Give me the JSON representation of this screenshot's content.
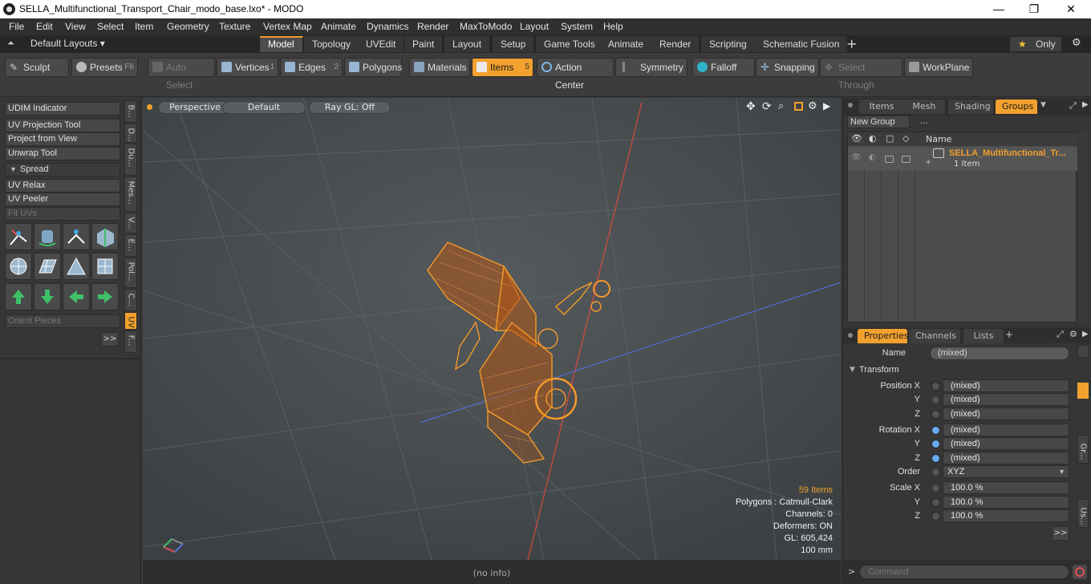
{
  "window": {
    "title": "SELLA_Multifunctional_Transport_Chair_modo_base.lxo* - MODO",
    "minimize": "—",
    "maximize": "❐",
    "close": "✕"
  },
  "menu": [
    "File",
    "Edit",
    "View",
    "Select",
    "Item",
    "Geometry",
    "Texture",
    "Vertex Map",
    "Animate",
    "Dynamics",
    "Render",
    "MaxToModo",
    "Layout",
    "System",
    "Help"
  ],
  "layout_selector": "Default Layouts ▾",
  "tabs": [
    "Model",
    "Topology",
    "UVEdit",
    "Paint",
    "Layout",
    "Setup",
    "Game Tools",
    "Animate",
    "Render",
    "Scripting",
    "Schematic Fusion"
  ],
  "active_tab": "Model",
  "only_label": "Only",
  "toolbar": {
    "sculpt": "Sculpt",
    "presets": "Presets",
    "presets_key": "F6",
    "auto_select": "Auto Select",
    "vertices": "Vertices",
    "vertices_num": "1",
    "edges": "Edges",
    "edges_num": "2",
    "polygons": "Polygons",
    "materials": "Materials",
    "items": "Items",
    "items_num": "5",
    "action_center": "Action Center",
    "symmetry": "Symmetry",
    "falloff": "Falloff",
    "snapping": "Snapping",
    "select_through": "Select Through",
    "workplane": "WorkPlane"
  },
  "left_panel": {
    "udim": "UDIM Indicator",
    "uv_projection": "UV Projection Tool",
    "project_from_view": "Project from View",
    "unwrap": "Unwrap Tool",
    "spread": "Spread",
    "uv_relax": "UV Relax",
    "uv_peeler": "UV Peeler",
    "fit_uvs": "Fit UVs",
    "orient_pieces": "Orient Pieces",
    "more": ">>",
    "vtabs": [
      "B...",
      "D...",
      "Du...",
      "Mes...",
      "V...",
      "E...",
      "Pol...",
      "C...",
      "UV",
      "F..."
    ]
  },
  "viewport": {
    "view": "Perspective",
    "shading": "Default",
    "raygl": "Ray GL: Off",
    "stats": {
      "items": "59 Items",
      "polygons": "Polygons : Catmull-Clark",
      "channels": "Channels: 0",
      "deformers": "Deformers: ON",
      "gl": "GL: 605,424",
      "scale": "100 mm"
    }
  },
  "status": "(no info)",
  "right_panel": {
    "tabs": [
      "Items",
      "Mesh ...",
      "Shading",
      "Groups"
    ],
    "active_tab": "Groups",
    "new_group": "New Group",
    "col_name": "Name",
    "group_name": "SELLA_Multifunctional_Tr...",
    "group_count": "1 Item",
    "prop_tabs": [
      "Properties",
      "Channels",
      "Lists"
    ],
    "name_label": "Name",
    "name_value": "(mixed)",
    "transform": "Transform",
    "position_x": "Position X",
    "y": "Y",
    "z": "Z",
    "rotation_x": "Rotation X",
    "order": "Order",
    "order_value": "XYZ",
    "scale_x": "Scale X",
    "mixed": "(mixed)",
    "scale_value": "100.0 %",
    "side_tabs": [
      "Gr...",
      "Us..."
    ],
    "more": ">>",
    "command_placeholder": "Command"
  },
  "colors": {
    "accent": "#f2a12e",
    "model": "#f49a2a"
  }
}
